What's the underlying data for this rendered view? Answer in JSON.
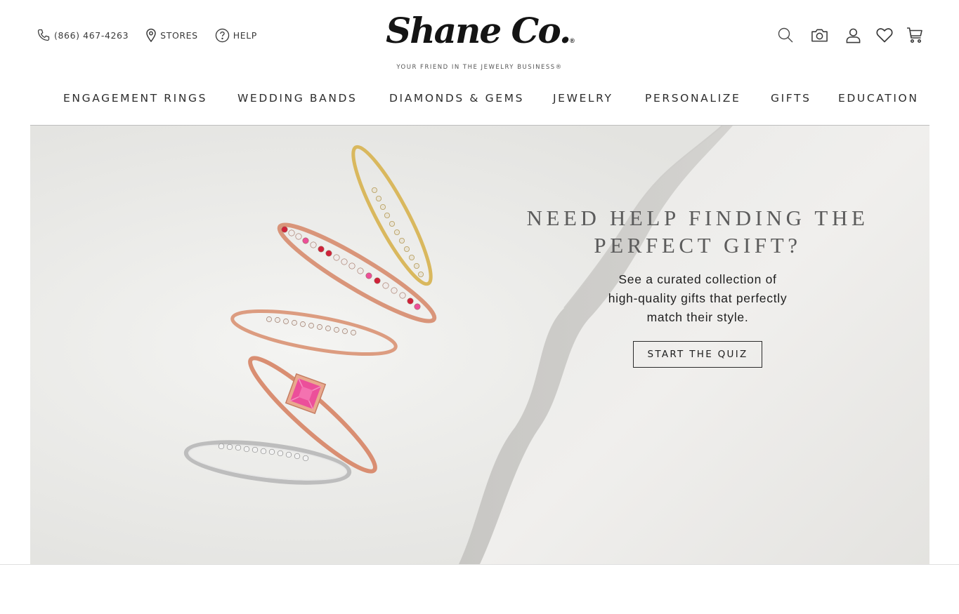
{
  "utility": {
    "phone": "(866) 467-4263",
    "stores": "STORES",
    "help": "HELP"
  },
  "logo": {
    "name": "Shane Co.",
    "registered": "®",
    "tagline": "YOUR FRIEND IN THE JEWELRY BUSINESS®"
  },
  "header_icons": [
    "search-icon",
    "camera-icon",
    "account-icon",
    "heart-icon",
    "cart-icon"
  ],
  "nav": {
    "items": [
      {
        "label": "ENGAGEMENT RINGS"
      },
      {
        "label": "WEDDING BANDS"
      },
      {
        "label": "DIAMONDS & GEMS"
      },
      {
        "label": "JEWELRY"
      },
      {
        "label": "PERSONALIZE"
      },
      {
        "label": "GIFTS"
      },
      {
        "label": "EDUCATION"
      }
    ]
  },
  "hero": {
    "title_line1": "NEED HELP FINDING THE",
    "title_line2": "PERFECT GIFT?",
    "sub_line1": "See a curated collection of",
    "sub_line2": "high-quality gifts that perfectly",
    "sub_line3": "match their style.",
    "cta_label": "START THE QUIZ"
  },
  "colors": {
    "text": "#2d2d2d",
    "title": "#5b5b5b",
    "rose_gold": "#d9957a",
    "yellow_gold": "#d9b85e",
    "ruby": "#d0213a",
    "pink_sapphire": "#ec4f9a",
    "white_gold": "#bfbfbf"
  }
}
